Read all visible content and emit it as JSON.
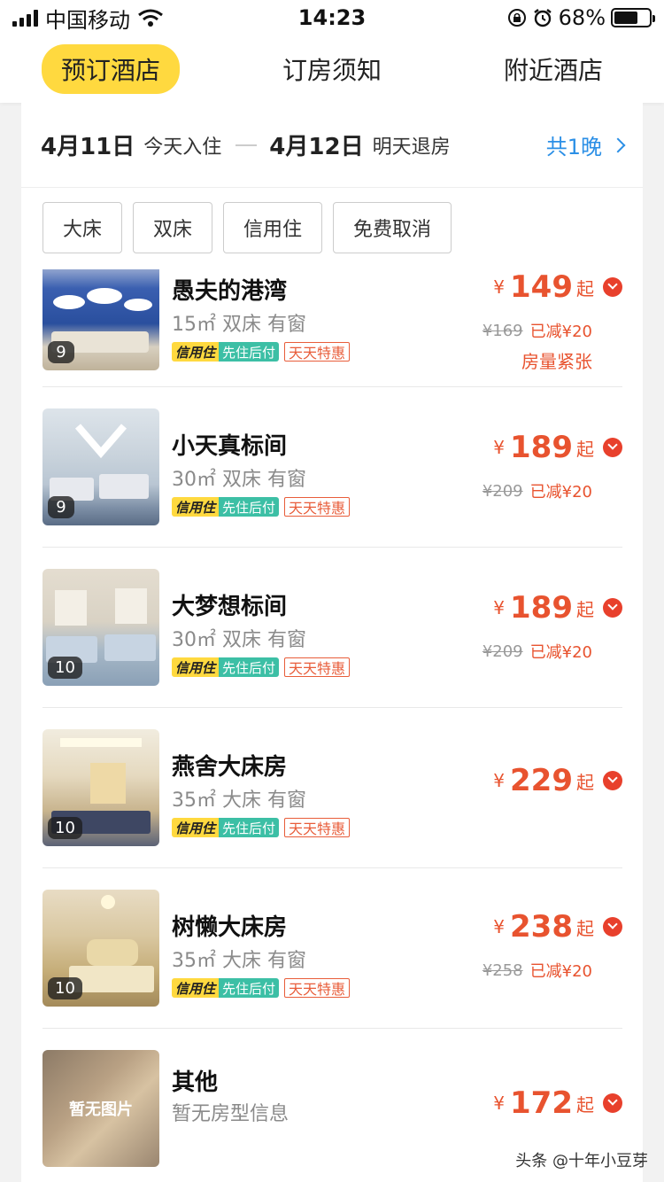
{
  "status_bar": {
    "carrier": "中国移动",
    "time": "14:23",
    "battery": "68%"
  },
  "nav": {
    "tabs": [
      "预订酒店",
      "订房须知",
      "附近酒店"
    ],
    "active_index": 0
  },
  "booking": {
    "checkin_date": "4月11日",
    "checkin_label": "今天入住",
    "checkout_date": "4月12日",
    "checkout_label": "明天退房",
    "nights": "共1晚"
  },
  "filters": [
    "大床",
    "双床",
    "信用住",
    "免费取消"
  ],
  "tags": {
    "credit_a": "信用住",
    "credit_b": "先住后付",
    "daily": "天天特惠"
  },
  "rooms": [
    {
      "name": "愚夫的港湾",
      "spec": "15㎡ 双床 有窗",
      "photo_count": "9",
      "price_currency": "¥",
      "price": "149",
      "price_suffix": "起",
      "old_price": "¥169",
      "discount": "已减¥20",
      "note": "房量紧张"
    },
    {
      "name": "小天真标间",
      "spec": "30㎡ 双床 有窗",
      "photo_count": "9",
      "price_currency": "¥",
      "price": "189",
      "price_suffix": "起",
      "old_price": "¥209",
      "discount": "已减¥20"
    },
    {
      "name": "大梦想标间",
      "spec": "30㎡ 双床 有窗",
      "photo_count": "10",
      "price_currency": "¥",
      "price": "189",
      "price_suffix": "起",
      "old_price": "¥209",
      "discount": "已减¥20"
    },
    {
      "name": "燕舍大床房",
      "spec": "35㎡ 大床 有窗",
      "photo_count": "10",
      "price_currency": "¥",
      "price": "229",
      "price_suffix": "起"
    },
    {
      "name": "树懒大床房",
      "spec": "35㎡ 大床 有窗",
      "photo_count": "10",
      "price_currency": "¥",
      "price": "238",
      "price_suffix": "起",
      "old_price": "¥258",
      "discount": "已减¥20"
    },
    {
      "name": "其他",
      "spec": "暂无房型信息",
      "no_image_text": "暂无图片",
      "price_currency": "¥",
      "price": "172",
      "price_suffix": "起"
    }
  ],
  "watermark": "头条 @十年小豆芽",
  "colors": {
    "accent_yellow": "#ffd93f",
    "price_red": "#e8532f",
    "link_blue": "#2b8fe6",
    "credit_green": "#3cbfa5"
  }
}
